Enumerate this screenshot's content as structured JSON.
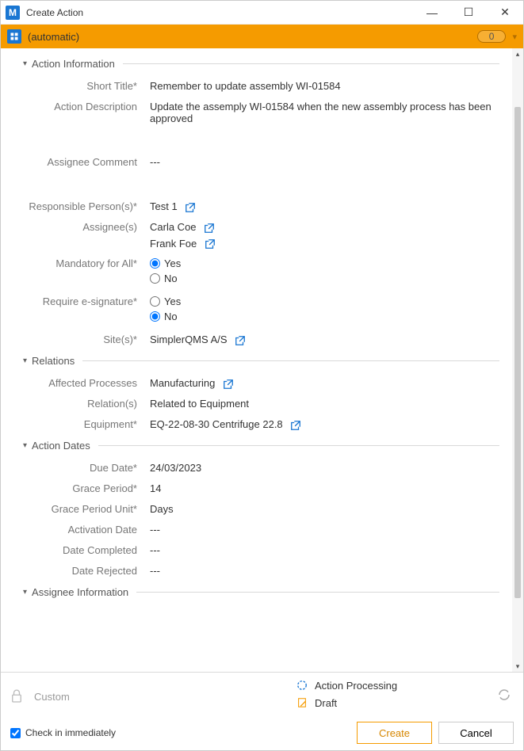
{
  "window": {
    "title": "Create Action"
  },
  "orangeBar": {
    "title": "(automatic)",
    "count": "0"
  },
  "sections": {
    "actionInfo": {
      "title": "Action Information",
      "shortTitle_label": "Short Title*",
      "shortTitle_value": "Remember to update assembly WI-01584",
      "actionDesc_label": "Action Description",
      "actionDesc_value": "Update the assemply WI-01584 when the new assembly process has been approved",
      "assigneeComment_label": "Assignee Comment",
      "assigneeComment_value": "---",
      "responsible_label": "Responsible Person(s)*",
      "responsible_value": "Test 1",
      "assignees_label": "Assignee(s)",
      "assignee1": "Carla Coe",
      "assignee2": "Frank Foe",
      "mandatory_label": "Mandatory for All*",
      "mandatory_yes": "Yes",
      "mandatory_no": "No",
      "mandatory_selected": "yes",
      "esig_label": "Require e-signature*",
      "esig_yes": "Yes",
      "esig_no": "No",
      "esig_selected": "no",
      "sites_label": "Site(s)*",
      "sites_value": "SimplerQMS A/S"
    },
    "relations": {
      "title": "Relations",
      "affected_label": "Affected Processes",
      "affected_value": "Manufacturing",
      "relations_label": "Relation(s)",
      "relations_value": "Related to Equipment",
      "equipment_label": "Equipment*",
      "equipment_value": "EQ-22-08-30 Centrifuge 22.8"
    },
    "dates": {
      "title": "Action Dates",
      "due_label": "Due Date*",
      "due_value": "24/03/2023",
      "grace_label": "Grace Period*",
      "grace_value": "14",
      "unit_label": "Grace Period Unit*",
      "unit_value": "Days",
      "activation_label": "Activation Date",
      "activation_value": "---",
      "completed_label": "Date Completed",
      "completed_value": "---",
      "rejected_label": "Date Rejected",
      "rejected_value": "---"
    },
    "assigneeInfo": {
      "title": "Assignee Information"
    }
  },
  "footer": {
    "custom_label": "Custom",
    "status1": "Action Processing",
    "status2": "Draft",
    "checkin_label": "Check in immediately",
    "create_btn": "Create",
    "cancel_btn": "Cancel"
  }
}
